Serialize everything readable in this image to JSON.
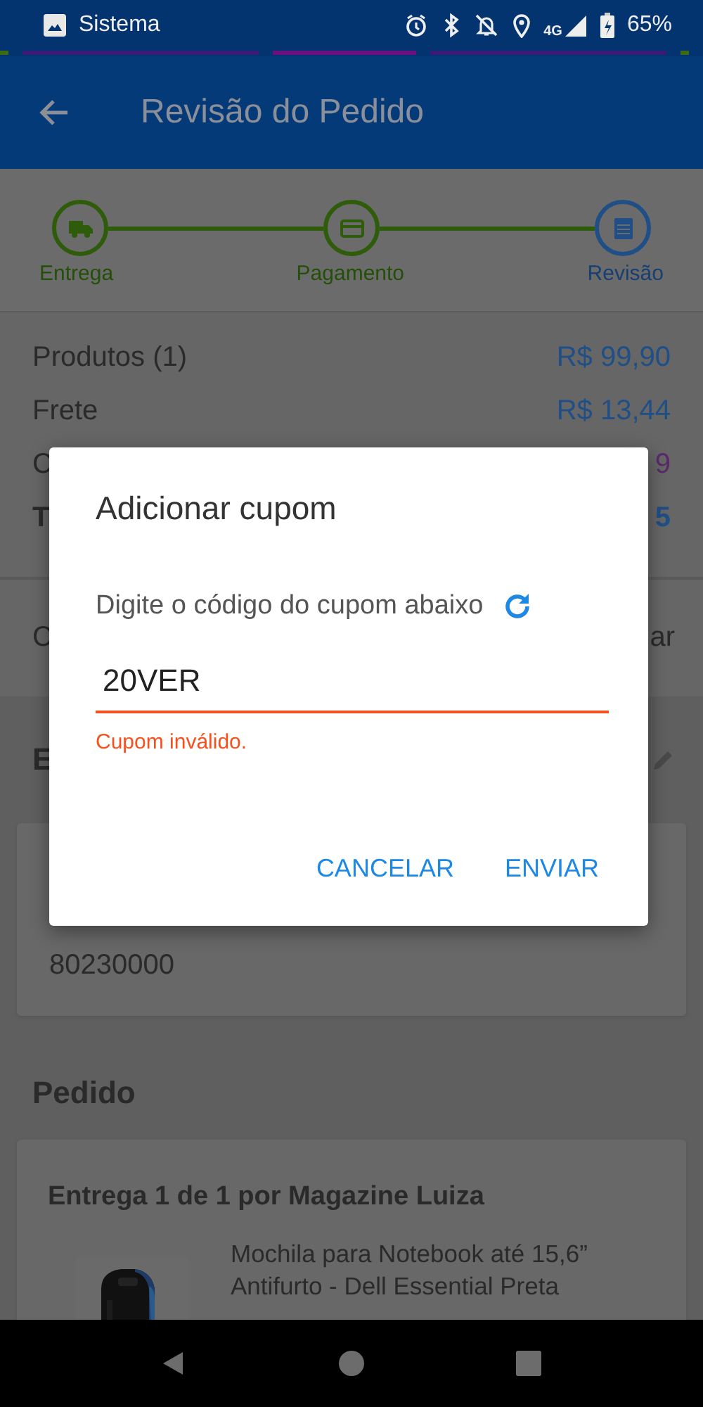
{
  "status_bar": {
    "app": "Sistema",
    "network": "4G",
    "battery": "65%"
  },
  "app_bar": {
    "title": "Revisão do Pedido"
  },
  "stepper": [
    {
      "label": "Entrega",
      "kind": "truck",
      "current": false
    },
    {
      "label": "Pagamento",
      "kind": "card",
      "current": false
    },
    {
      "label": "Revisão",
      "kind": "document",
      "current": true
    }
  ],
  "summary": [
    {
      "label": "Produtos (1)",
      "value": "R$ 99,90",
      "kind": "price"
    },
    {
      "label": "Frete",
      "value": "R$ 13,44",
      "kind": "price"
    },
    {
      "label": "C",
      "value": "9",
      "kind": "discount"
    },
    {
      "label": "T",
      "value": "5",
      "kind": "total"
    }
  ],
  "coupon_row": {
    "label": "C",
    "action": "ar"
  },
  "address": {
    "heading": "E",
    "zip": "80230000"
  },
  "order": {
    "heading": "Pedido",
    "delivery": "Entrega 1 de 1 por Magazine Luiza",
    "product": {
      "title": "Mochila para Notebook até 15,6” Antifurto - Dell Essential Preta"
    }
  },
  "dialog": {
    "title": "Adicionar cupom",
    "prompt": "Digite o código do cupom abaixo",
    "value": "20VER",
    "error": "Cupom inválido.",
    "buttons": [
      "CANCELAR",
      "ENVIAR"
    ]
  },
  "nav_bar": [
    {
      "kind": "back"
    },
    {
      "kind": "home"
    },
    {
      "kind": "recents"
    }
  ]
}
